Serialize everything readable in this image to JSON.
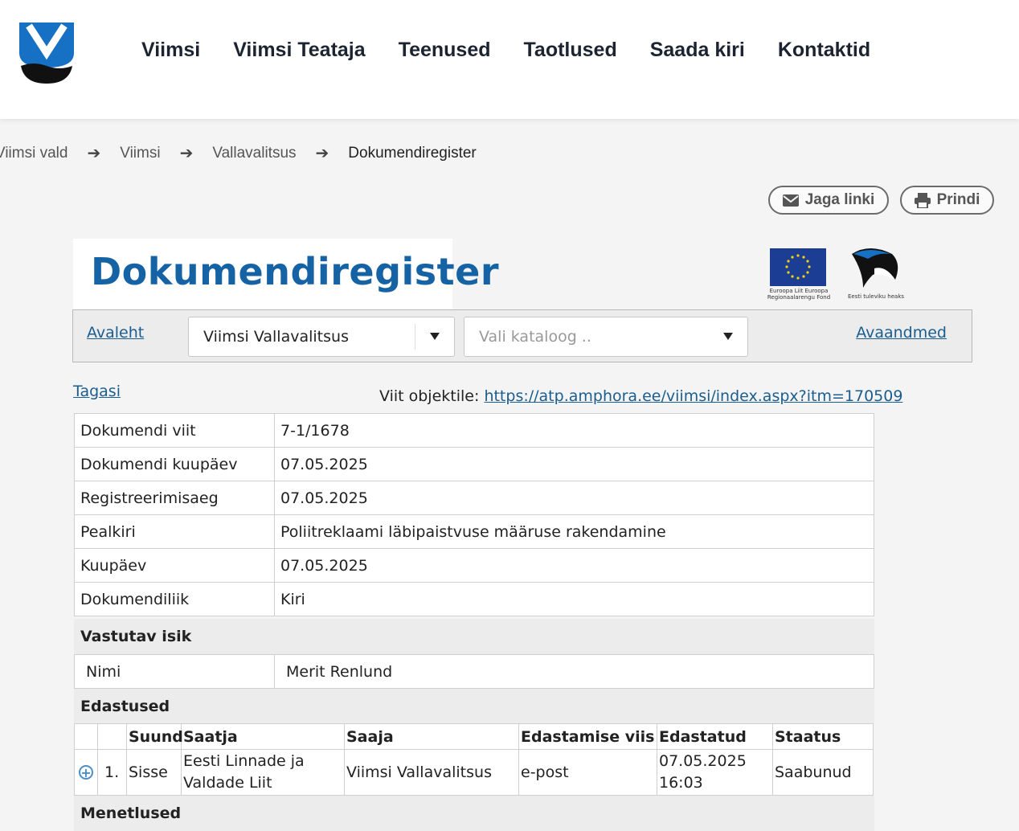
{
  "header": {
    "nav": [
      "Viimsi",
      "Viimsi Teataja",
      "Teenused",
      "Taotlused",
      "Saada kiri",
      "Kontaktid"
    ],
    "brand_color": "#1670c4"
  },
  "breadcrumb": {
    "items": [
      "Viimsi vald",
      "Viimsi",
      "Vallavalitsus"
    ],
    "current": "Dokumendiregister"
  },
  "actions": {
    "share_label": "Jaga linki",
    "share_icon": "envelope-icon",
    "print_label": "Prindi",
    "print_icon": "printer-icon"
  },
  "register": {
    "title": "Dokumendiregister",
    "eu_logo_text": "Euroopa Liit Euroopa Regionaalarengu Fond",
    "est_logo_text": "Eesti tuleviku heaks"
  },
  "toolbar": {
    "home_link": "Avaleht",
    "org_select_value": "Viimsi Vallavalitsus",
    "catalog_placeholder": "Vali kataloog ..",
    "open_data_link": "Avaandmed"
  },
  "document": {
    "back_link": "Tagasi",
    "direct_link_label": "Viit objektile:",
    "direct_link_url": "https://atp.amphora.ee/viimsi/index.aspx?itm=170509",
    "fields": [
      {
        "label": "Dokumendi viit",
        "value": "7-1/1678"
      },
      {
        "label": "Dokumendi kuupäev",
        "value": "07.05.2025"
      },
      {
        "label": "Registreerimisaeg",
        "value": "07.05.2025"
      },
      {
        "label": "Pealkiri",
        "value": "Poliitreklaami läbipaistvuse määruse rakendamine"
      },
      {
        "label": "Kuupäev",
        "value": "07.05.2025"
      },
      {
        "label": "Dokumendiliik",
        "value": "Kiri"
      }
    ],
    "responsible_heading": "Vastutav isik",
    "responsible": {
      "label": "Nimi",
      "value": "Merit Renlund"
    },
    "deliveries_heading": "Edastused",
    "deliveries_columns": [
      "Suund",
      "Saatja",
      "Saaja",
      "Edastamise viis",
      "Edastatud",
      "Staatus"
    ],
    "deliveries": [
      {
        "index": "1.",
        "direction": "Sisse",
        "sender": "Eesti Linnade ja Valdade Liit",
        "recipient": "Viimsi Vallavalitsus",
        "method": "e-post",
        "date": "07.05.2025",
        "time": "16:03",
        "status": "Saabunud"
      }
    ],
    "procedures_heading": "Menetlused"
  }
}
